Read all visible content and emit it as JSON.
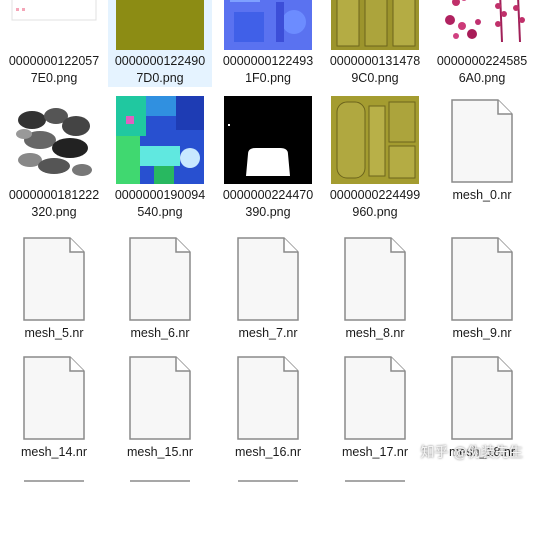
{
  "files": [
    {
      "name": "00000001220577E0.png",
      "l1": "0000000122057",
      "l2": "7E0.png",
      "kind": "white"
    },
    {
      "name": "00000001224907D0.png",
      "l1": "0000000122490",
      "l2": "7D0.png",
      "kind": "olive",
      "selected": true
    },
    {
      "name": "00000001224931F0.png",
      "l1": "0000000122493",
      "l2": "1F0.png",
      "kind": "normal"
    },
    {
      "name": "00000001314789C0.png",
      "l1": "0000000131478",
      "l2": "9C0.png",
      "kind": "ornament"
    },
    {
      "name": "00000002245856A0.png",
      "l1": "0000000224585",
      "l2": "6A0.png",
      "kind": "flowers"
    },
    {
      "name": "0000000181222320.png",
      "l1": "0000000181222",
      "l2": "320.png",
      "kind": "clouds"
    },
    {
      "name": "0000000190094540.png",
      "l1": "0000000190094",
      "l2": "540.png",
      "kind": "colorful"
    },
    {
      "name": "0000000224470390.png",
      "l1": "0000000224470",
      "l2": "390.png",
      "kind": "mask"
    },
    {
      "name": "0000000224499960.png",
      "l1": "0000000224499",
      "l2": "960.png",
      "kind": "ornament2"
    },
    {
      "name": "mesh_0.nr",
      "l1": "mesh_0.nr",
      "l2": "",
      "kind": "file"
    },
    {
      "name": "mesh_5.nr",
      "l1": "mesh_5.nr",
      "l2": "",
      "kind": "file"
    },
    {
      "name": "mesh_6.nr",
      "l1": "mesh_6.nr",
      "l2": "",
      "kind": "file"
    },
    {
      "name": "mesh_7.nr",
      "l1": "mesh_7.nr",
      "l2": "",
      "kind": "file"
    },
    {
      "name": "mesh_8.nr",
      "l1": "mesh_8.nr",
      "l2": "",
      "kind": "file"
    },
    {
      "name": "mesh_9.nr",
      "l1": "mesh_9.nr",
      "l2": "",
      "kind": "file"
    },
    {
      "name": "mesh_14.nr",
      "l1": "mesh_14.nr",
      "l2": "",
      "kind": "file"
    },
    {
      "name": "mesh_15.nr",
      "l1": "mesh_15.nr",
      "l2": "",
      "kind": "file"
    },
    {
      "name": "mesh_16.nr",
      "l1": "mesh_16.nr",
      "l2": "",
      "kind": "file"
    },
    {
      "name": "mesh_17.nr",
      "l1": "mesh_17.nr",
      "l2": "",
      "kind": "file"
    },
    {
      "name": "mesh_18.nr",
      "l1": "mesh_18.nr",
      "l2": "",
      "kind": "file"
    }
  ],
  "watermark": "知乎 @伪装先生",
  "colors": {
    "selection": "#e5f3ff",
    "olive": "#8c8c14",
    "text": "#1a1a1a"
  }
}
